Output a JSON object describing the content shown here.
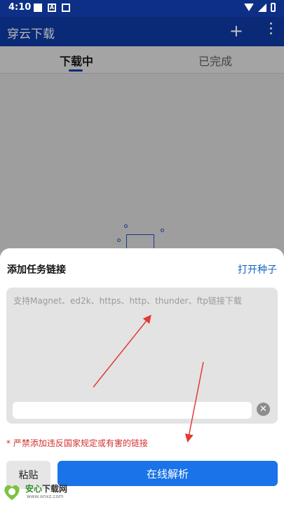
{
  "status_bar": {
    "time": "4:10",
    "notif_letter": "A"
  },
  "app_bar": {
    "title": "穿云下载",
    "add_icon": "plus-icon",
    "more_icon": "more-vert-icon"
  },
  "tabs": [
    {
      "label": "下载中",
      "selected": true
    },
    {
      "label": "已完成",
      "selected": false
    }
  ],
  "sheet": {
    "title": "添加任务链接",
    "open_torrent": "打开种子",
    "link_placeholder": "支持Magnet、ed2k、https、http、thunder、ftp链接下载",
    "warning": "* 严禁添加违反国家规定或有害的链接",
    "paste_label": "粘贴",
    "parse_label": "在线解析"
  },
  "watermark": {
    "text_a": "安心",
    "text_b": "下载网",
    "url": "www.anxz.com"
  },
  "colors": {
    "appbar": "#0a2a78",
    "accent": "#1a73e8",
    "warning": "#d32f2f",
    "arrow": "#e53935"
  }
}
